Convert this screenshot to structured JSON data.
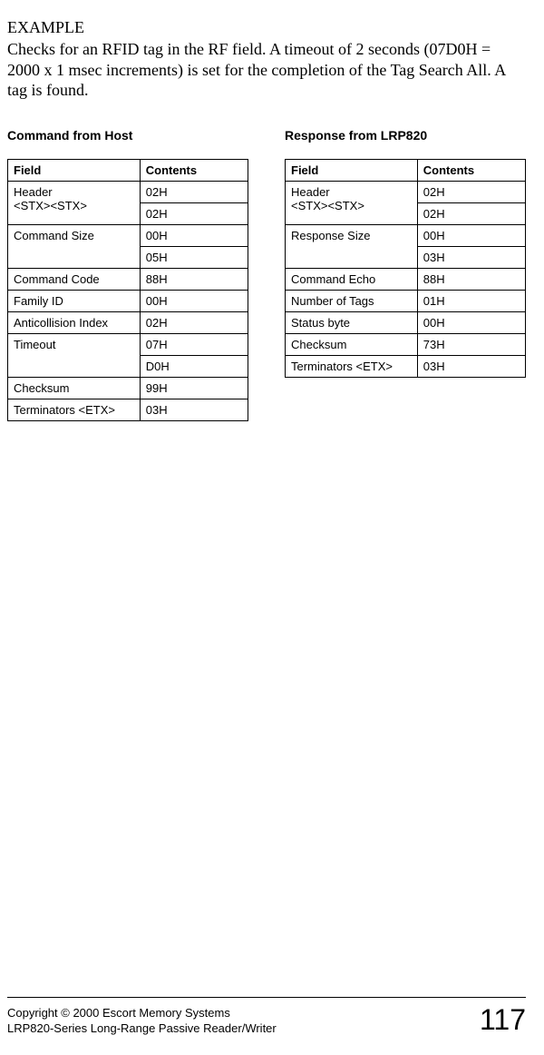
{
  "example_label": "EXAMPLE",
  "description": "Checks for an RFID tag in the RF field. A timeout of 2 seconds (07D0H = 2000 x 1 msec increments) is set for the completion of the Tag Search All. A tag is found.",
  "command_table": {
    "title": "Command from Host",
    "headers": {
      "field": "Field",
      "contents": "Contents"
    },
    "rows": [
      {
        "field": "Header\n<STX><STX>",
        "contents": "02H",
        "rowspan": 2
      },
      {
        "field": "",
        "contents": "02H"
      },
      {
        "field": "Command Size",
        "contents": "00H",
        "rowspan": 2
      },
      {
        "field": "",
        "contents": "05H"
      },
      {
        "field": "Command Code",
        "contents": "88H"
      },
      {
        "field": "Family ID",
        "contents": "00H"
      },
      {
        "field": "Anticollision Index",
        "contents": "02H"
      },
      {
        "field": "Timeout",
        "contents": "07H",
        "rowspan": 2
      },
      {
        "field": "",
        "contents": "D0H"
      },
      {
        "field": "Checksum",
        "contents": "99H"
      },
      {
        "field": "Terminators <ETX>",
        "contents": "03H"
      }
    ]
  },
  "response_table": {
    "title": "Response from LRP820",
    "headers": {
      "field": "Field",
      "contents": "Contents"
    },
    "rows": [
      {
        "field": "Header\n<STX><STX>",
        "contents": "02H",
        "rowspan": 2
      },
      {
        "field": "",
        "contents": "02H"
      },
      {
        "field": "Response Size",
        "contents": "00H",
        "rowspan": 2
      },
      {
        "field": "",
        "contents": "03H"
      },
      {
        "field": "Command Echo",
        "contents": "88H"
      },
      {
        "field": "Number of Tags",
        "contents": "01H"
      },
      {
        "field": "Status byte",
        "contents": "00H"
      },
      {
        "field": "Checksum",
        "contents": "73H"
      },
      {
        "field": "Terminators <ETX>",
        "contents": "03H"
      }
    ]
  },
  "footer": {
    "copyright": "Copyright © 2000 Escort Memory Systems",
    "product": "LRP820-Series Long-Range Passive Reader/Writer",
    "page": "117"
  }
}
